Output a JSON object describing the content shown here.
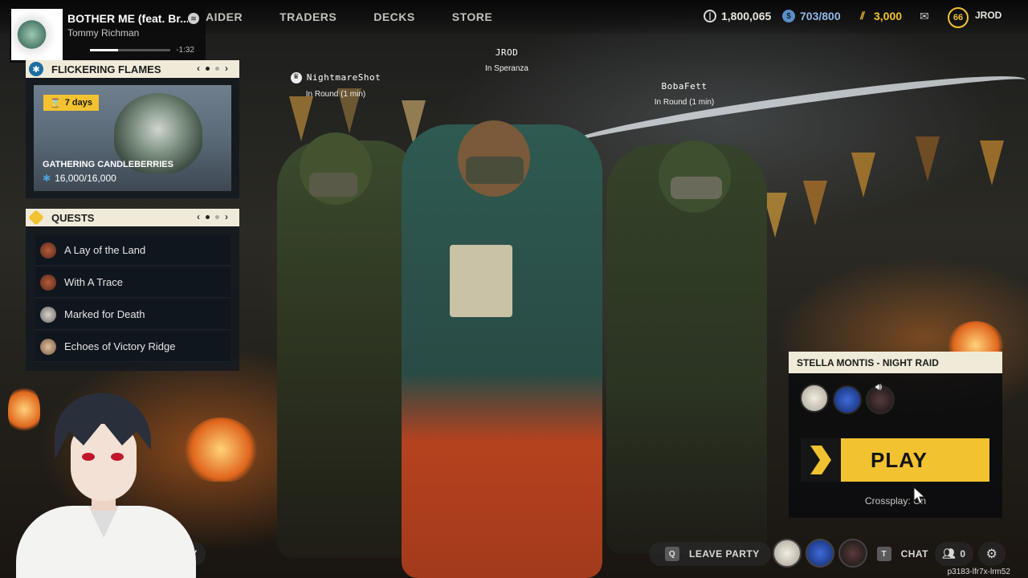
{
  "music": {
    "title": "BOTHER ME (feat. Br...",
    "artist": "Tommy Richman",
    "time_left": "-1:32",
    "progress": 0.35
  },
  "nav": {
    "items": [
      "AIDER",
      "TRADERS",
      "DECKS",
      "STORE"
    ]
  },
  "currencies": {
    "coins": "1,800,065",
    "raider_tokens": "703/800",
    "credits": "3,000",
    "level": "66",
    "username": "JROD"
  },
  "event": {
    "header": "FLICKERING FLAMES",
    "timer": "7 days",
    "title": "GATHERING CANDLEBERRIES",
    "progress": "16,000/16,000"
  },
  "quests": {
    "header": "QUESTS",
    "items": [
      {
        "label": "A Lay of the Land",
        "icon": "raider-face-icon"
      },
      {
        "label": "With A Trace",
        "icon": "raider-face-icon"
      },
      {
        "label": "Marked for Death",
        "icon": "trader-portrait-icon"
      },
      {
        "label": "Echoes of Victory Ridge",
        "icon": "trader-portrait-icon"
      }
    ]
  },
  "players": [
    {
      "name": "NightmareShot",
      "status": "In Round (1 min)"
    },
    {
      "name": "JROD",
      "status": "In Speranza"
    },
    {
      "name": "BobaFett",
      "status": "In Round (1 min)"
    }
  ],
  "matchmaking": {
    "mode": "STELLA MONTIS - NIGHT RAID",
    "play_label": "PLAY",
    "crossplay": "Crossplay: On"
  },
  "bottom": {
    "leave_key": "Q",
    "leave_label": "LEAVE PARTY",
    "chat_key": "T",
    "chat_label": "CHAT",
    "friends_count": "0",
    "session_id": "p3183-lfr7x-lrm52",
    "obscured_label": "Y"
  },
  "colors": {
    "accent": "#f2c230",
    "panel_header": "#f0ebd9"
  }
}
